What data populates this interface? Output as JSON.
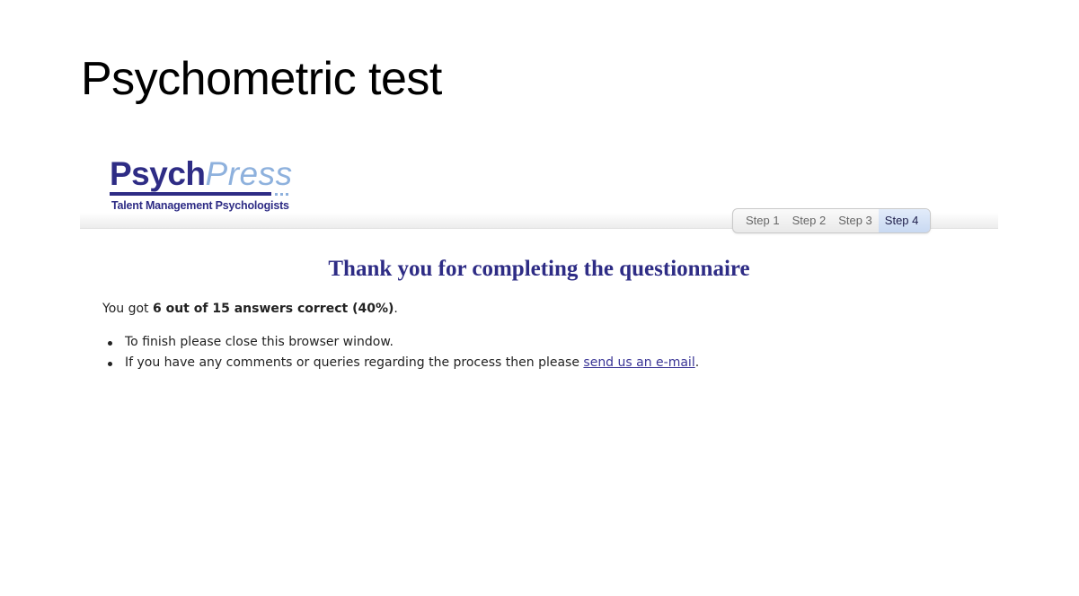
{
  "slide": {
    "title": "Psychometric test"
  },
  "logo": {
    "brand_part1": "Psych",
    "brand_part2": "Press",
    "tagline": "Talent Management Psychologists"
  },
  "steps": {
    "items": [
      "Step 1",
      "Step 2",
      "Step 3",
      "Step 4"
    ],
    "active": "Step 4"
  },
  "content": {
    "heading": "Thank you for completing the questionnaire",
    "result_prefix": "You got ",
    "result_bold": "6 out of 15 answers correct (40%)",
    "result_suffix": ".",
    "bullet_1": "To finish please close this browser window.",
    "bullet_2_prefix": "If you have any comments or queries regarding the process then please ",
    "bullet_2_link": "send us an e-mail",
    "bullet_2_suffix": "."
  },
  "colors": {
    "brand_dark": "#2e2c85",
    "brand_light": "#8eb1dd",
    "link": "#3a3596"
  }
}
